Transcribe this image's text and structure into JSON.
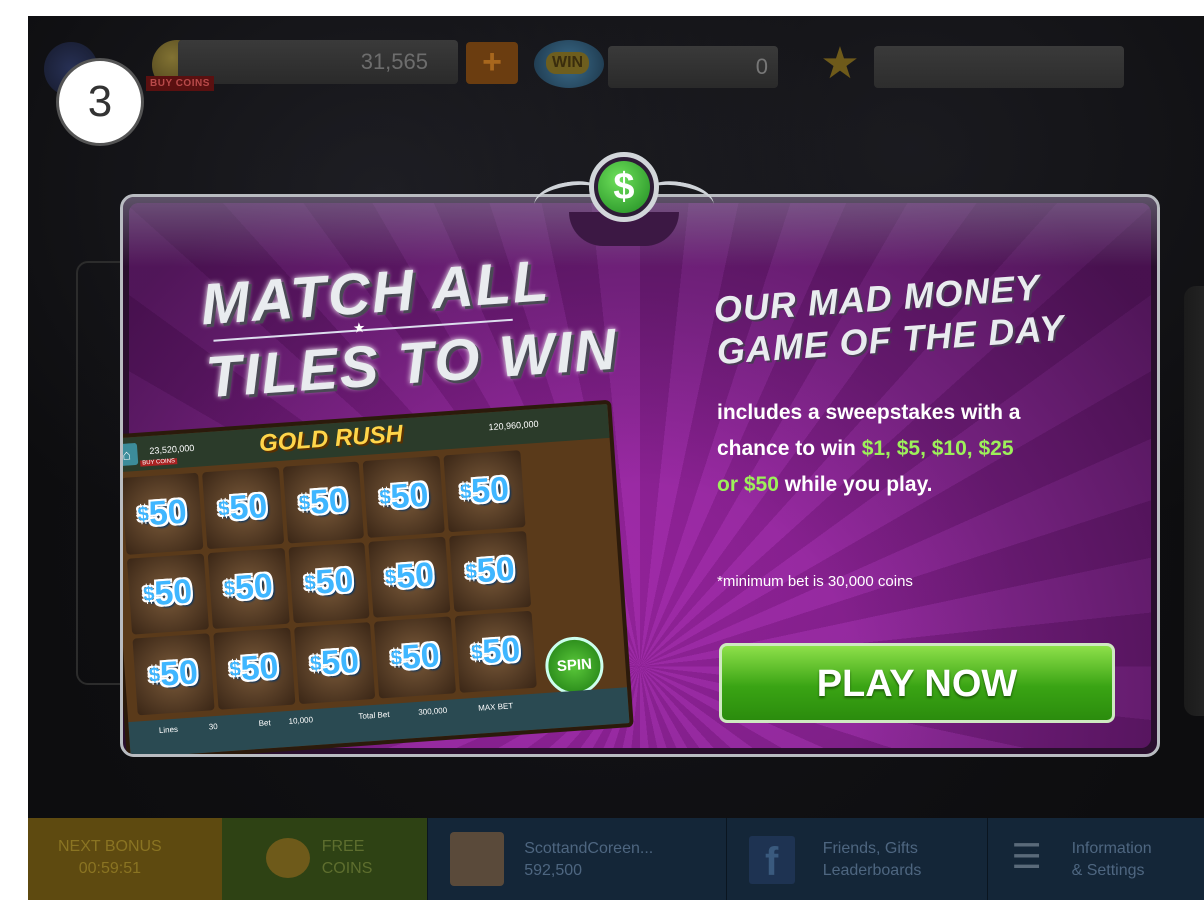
{
  "step_badge": "3",
  "topbar": {
    "buy_coins_label": "BUY COINS",
    "coins_value": "31,565",
    "plus_label": "+",
    "win_label": "WIN",
    "win_value": "0",
    "star_icon": "★"
  },
  "modal": {
    "emblem_symbol": "$",
    "match_line1": "MATCH ALL",
    "match_line2": "TILES TO WIN",
    "mad_line1": "OUR MAD MONEY",
    "mad_line2": "GAME OF THE DAY",
    "desc_part1": "includes a sweepstakes with a chance to win ",
    "desc_amounts1": "$1, $5, $10, $25",
    "desc_part2": " ",
    "desc_amounts2": "or $50",
    "desc_part3": "  while you play.",
    "min_bet": "*minimum bet is 30,000 coins",
    "play_button": "PLAY NOW"
  },
  "slot_preview": {
    "title": "GOLD RUSH",
    "coins": "23,520,000",
    "buy": "BUY COINS",
    "win": "120,960,000",
    "tile_value": "50",
    "tile_currency": "$",
    "spin_label": "SPIN",
    "lines_label": "Lines",
    "lines_value": "30",
    "bet_label": "Bet",
    "bet_value": "10,000",
    "total_bet_label": "Total Bet",
    "total_bet_value": "300,000",
    "max_bet_label": "MAX BET"
  },
  "bottombar": {
    "bonus_label": "NEXT BONUS",
    "bonus_timer": "00:59:51",
    "free_line1": "FREE",
    "free_line2": "COINS",
    "user_name": "ScottandCoreen...",
    "user_coins": "592,500",
    "friends_line1": "Friends, Gifts",
    "friends_line2": "Leaderboards",
    "fb_glyph": "f",
    "info_line1": "Information",
    "info_line2": "& Settings"
  }
}
